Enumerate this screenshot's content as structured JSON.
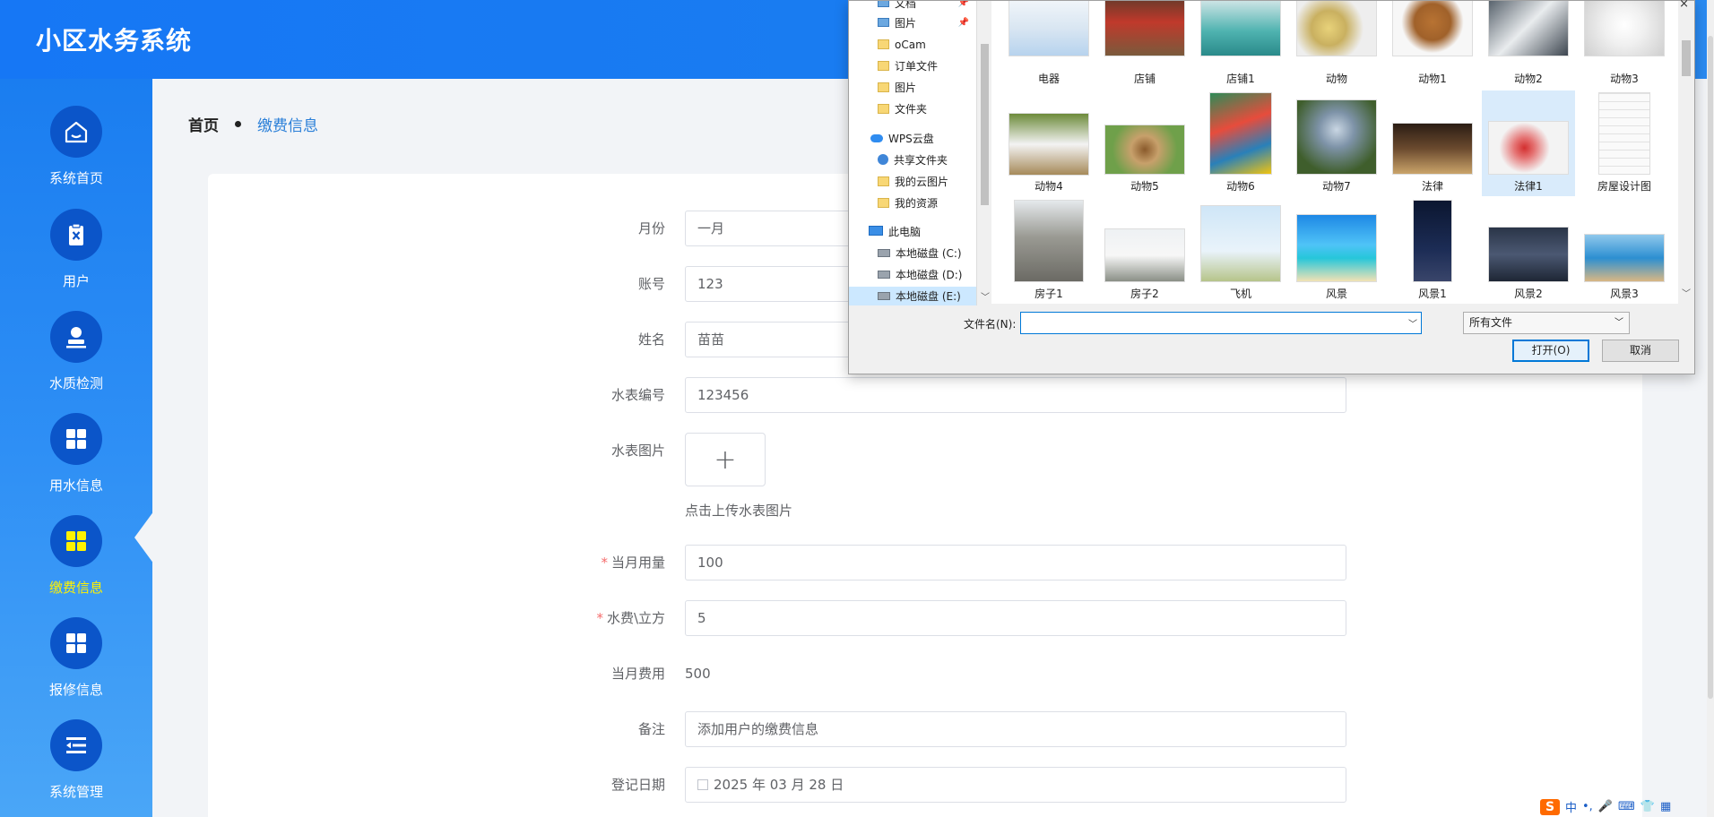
{
  "app": {
    "title": "小区水务系统"
  },
  "sidebar": {
    "items": [
      {
        "label": "系统首页",
        "icon": "home-icon",
        "active": false
      },
      {
        "label": "用户",
        "icon": "clipboard-x-icon",
        "active": false
      },
      {
        "label": "水质检测",
        "icon": "user-badge-icon",
        "active": false
      },
      {
        "label": "用水信息",
        "icon": "grid-icon",
        "active": false
      },
      {
        "label": "缴费信息",
        "icon": "grid-icon",
        "active": true
      },
      {
        "label": "报修信息",
        "icon": "grid-icon",
        "active": false
      },
      {
        "label": "系统管理",
        "icon": "list-menu-icon",
        "active": false
      }
    ],
    "active_color": "#fff200",
    "circle_color": "#0b55c9"
  },
  "breadcrumb": {
    "home": "首页",
    "current": "缴费信息"
  },
  "form": {
    "month": {
      "label": "月份",
      "value": "一月"
    },
    "account": {
      "label": "账号",
      "value": "123"
    },
    "name": {
      "label": "姓名",
      "value": "苗苗"
    },
    "meter_no": {
      "label": "水表编号",
      "value": "123456"
    },
    "meter_image": {
      "label": "水表图片",
      "plus": "+",
      "tip": "点击上传水表图片"
    },
    "usage": {
      "label": "当月用量",
      "required_mark": "*",
      "value": "100"
    },
    "price": {
      "label": "水费\\立方",
      "required_mark": "*",
      "value": "5"
    },
    "fee": {
      "label": "当月费用",
      "value": "500"
    },
    "remark": {
      "label": "备注",
      "value": "添加用户的缴费信息"
    },
    "date": {
      "label": "登记日期",
      "value": "2025 年 03 月 28 日"
    }
  },
  "file_dialog": {
    "tree": [
      {
        "label": "文档",
        "icon": "document-icon",
        "pinned": true
      },
      {
        "label": "图片",
        "icon": "pictures-icon",
        "pinned": true
      },
      {
        "label": "oCam",
        "icon": "folder-icon"
      },
      {
        "label": "订单文件",
        "icon": "folder-icon"
      },
      {
        "label": "图片",
        "icon": "folder-icon"
      },
      {
        "label": "文件夹",
        "icon": "folder-icon"
      },
      {
        "label": "WPS云盘",
        "icon": "cloud-icon"
      },
      {
        "label": "共享文件夹",
        "icon": "share-icon"
      },
      {
        "label": "我的云图片",
        "icon": "folder-icon"
      },
      {
        "label": "我的资源",
        "icon": "folder-icon"
      },
      {
        "label": "此电脑",
        "icon": "computer-icon"
      },
      {
        "label": "本地磁盘 (C:)",
        "icon": "drive-icon"
      },
      {
        "label": "本地磁盘 (D:)",
        "icon": "drive-icon"
      },
      {
        "label": "本地磁盘 (E:)",
        "icon": "drive-icon",
        "selected": true
      }
    ],
    "files": [
      {
        "name": "电器",
        "thumb": "air-conditioner"
      },
      {
        "name": "店铺",
        "thumb": "shop"
      },
      {
        "name": "店铺1",
        "thumb": "shop-interior"
      },
      {
        "name": "动物",
        "thumb": "chicks"
      },
      {
        "name": "动物1",
        "thumb": "puppy"
      },
      {
        "name": "动物2",
        "thumb": "white-tiger"
      },
      {
        "name": "动物3",
        "thumb": "goose"
      },
      {
        "name": "动物4",
        "thumb": "rabbits"
      },
      {
        "name": "动物5",
        "thumb": "beagle"
      },
      {
        "name": "动物6",
        "thumb": "bird"
      },
      {
        "name": "动物7",
        "thumb": "blue-bird"
      },
      {
        "name": "法律",
        "thumb": "gavel"
      },
      {
        "name": "法律1",
        "thumb": "law-puzzle",
        "selected": true
      },
      {
        "name": "房屋设计图",
        "thumb": "blueprint"
      },
      {
        "name": "房子1",
        "thumb": "house-construction"
      },
      {
        "name": "房子2",
        "thumb": "white-house"
      },
      {
        "name": "飞机",
        "thumb": "airplane"
      },
      {
        "name": "风景",
        "thumb": "palm-beach"
      },
      {
        "name": "风景1",
        "thumb": "night-sky"
      },
      {
        "name": "风景2",
        "thumb": "pier"
      },
      {
        "name": "风景3",
        "thumb": "coast"
      }
    ],
    "filename_label": "文件名(N):",
    "filename_value": "",
    "file_type": "所有文件",
    "open_label": "打开(O)",
    "cancel_label": "取消",
    "close_glyph": "×"
  },
  "tray": {
    "ime_logo": "S",
    "ime_lang": "中"
  },
  "colors": {
    "header": "#1677f5",
    "accent": "#2a7fd8",
    "required": "#f56c6c"
  }
}
